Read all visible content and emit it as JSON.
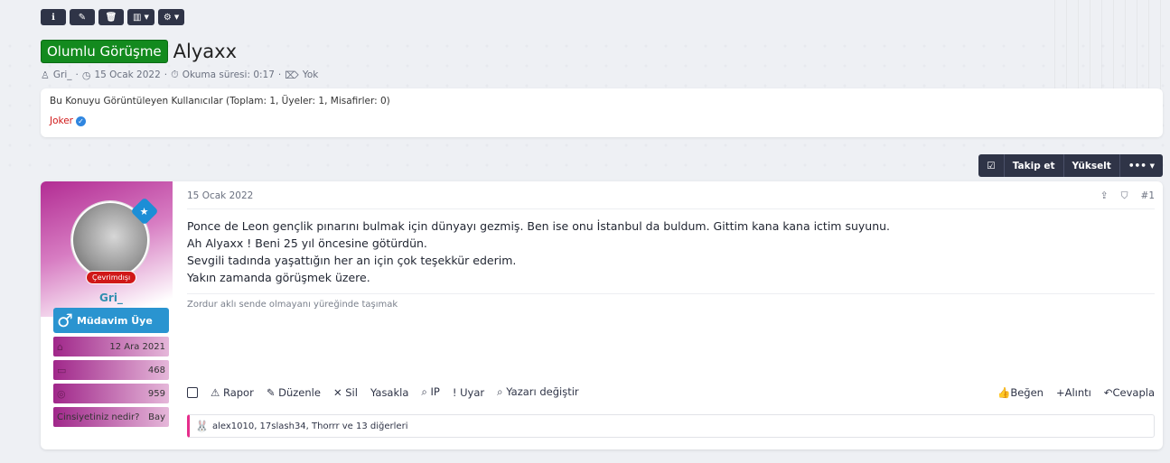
{
  "toolbar": {
    "info_icon": "info-icon",
    "edit_icon": "edit-icon",
    "delete_icon": "trash-icon",
    "chart_icon": "chart-icon",
    "gear_icon": "gear-icon"
  },
  "thread": {
    "prefix": "Olumlu Görüşme",
    "title": "Alyaxx",
    "author": "Gri_",
    "date": "15 Ocak 2022",
    "reading_time": "Okuma süresi: 0:17",
    "tags": "Yok"
  },
  "viewers": {
    "label": "Bu Konuyu Görüntüleyen Kullanıcılar (Toplam: 1, Üyeler: 1, Misafirler: 0)",
    "users": [
      "Joker"
    ]
  },
  "thread_actions": {
    "follow": "Takip et",
    "bump": "Yükselt",
    "more": "•••"
  },
  "post": {
    "user": {
      "status": "Çevrimdışı",
      "name": "Gri_",
      "rank": "Müdavim Üye",
      "joined": "12 Ara 2021",
      "messages": "468",
      "reactions": "959",
      "gender_label": "Cinsiyetiniz nedir?",
      "gender_value": "Bay"
    },
    "date": "15 Ocak 2022",
    "number": "#1",
    "lines": [
      "Ponce de Leon gençlik pınarını bulmak için dünyayı gezmiş. Ben ise onu İstanbul da buldum. Gittim kana kana ictim suyunu.",
      "Ah Alyaxx ! Beni 25 yıl öncesine götürdün.",
      "Sevgili tadında yaşattığın her an için çok teşekkür ederim.",
      "Yakın zamanda görüşmek üzere."
    ],
    "signature": "Zordur aklı sende olmayanı yüreğinde taşımak",
    "actions_left": {
      "report": "Rapor",
      "edit": "Düzenle",
      "delete": "Sil",
      "ban": "Yasakla",
      "ip": "IP",
      "warn": "Uyar",
      "change_author": "Yazarı değiştir"
    },
    "actions_right": {
      "like": "Beğen",
      "quote": "Alıntı",
      "reply": "Cevapla"
    },
    "likes_text": "alex1010, 17slash34, Thorrr ve 13 diğerleri"
  },
  "colors": {
    "prefix_green": "#138a1e",
    "toolbar_dark": "#2f3447",
    "rank_blue": "#2a94d0",
    "offline_red": "#d01818",
    "user_magenta": "#b22c93"
  }
}
